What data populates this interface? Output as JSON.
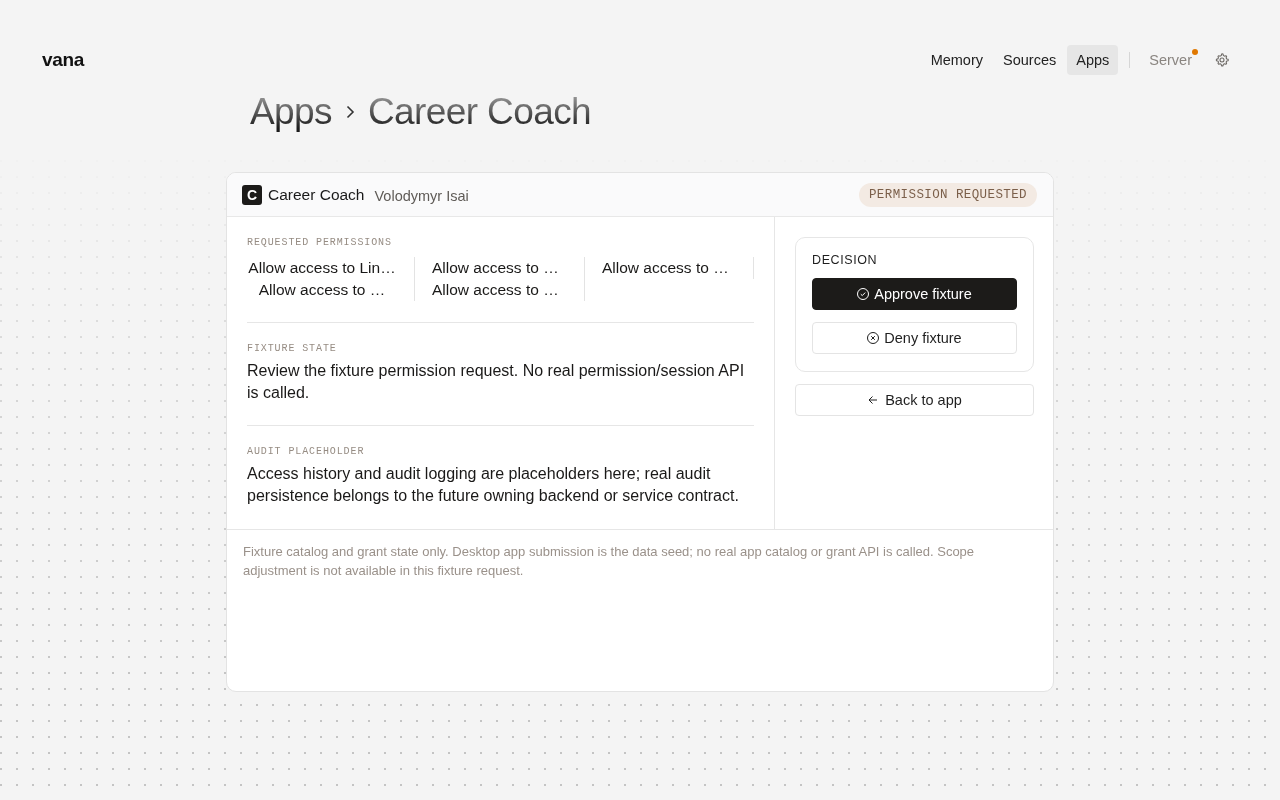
{
  "header": {
    "logo": "vana",
    "nav": [
      {
        "label": "Memory",
        "selected": false
      },
      {
        "label": "Sources",
        "selected": false
      },
      {
        "label": "Apps",
        "selected": true
      }
    ],
    "server": {
      "label": "Server",
      "alert": true
    }
  },
  "breadcrumb": [
    "Apps",
    "Career Coach"
  ],
  "card": {
    "header": {
      "monogram": "C",
      "title": "Career Coach",
      "author": "Volodymyr Isai",
      "status": "PERMISSION REQUESTED"
    },
    "sections": [
      {
        "kind": "permissions",
        "label": "REQUESTED PERMISSIONS",
        "items": [
          "Allow access to Lin…",
          "Allow access to …",
          "Allow access to …",
          "Allow access to …",
          "Allow access to …"
        ]
      },
      {
        "kind": "text",
        "label": "FIXTURE STATE",
        "text": "Review the fixture permission request. No real permission/session API is called."
      },
      {
        "kind": "text",
        "label": "AUDIT PLACEHOLDER",
        "text": "Access history and audit logging are placeholders here; real audit persistence belongs to the future owning backend or service contract."
      }
    ],
    "decision": {
      "label": "DECISION",
      "buttons": [
        {
          "label": "Approve fixture",
          "kind": "approve"
        },
        {
          "label": "Deny fixture",
          "kind": "deny"
        }
      ]
    },
    "back_button": "Back to app",
    "footer_note": "Fixture catalog and grant state only. Desktop app submission is the data seed; no real app catalog or grant API is called. Scope adjustment is not available in this fixture request."
  }
}
